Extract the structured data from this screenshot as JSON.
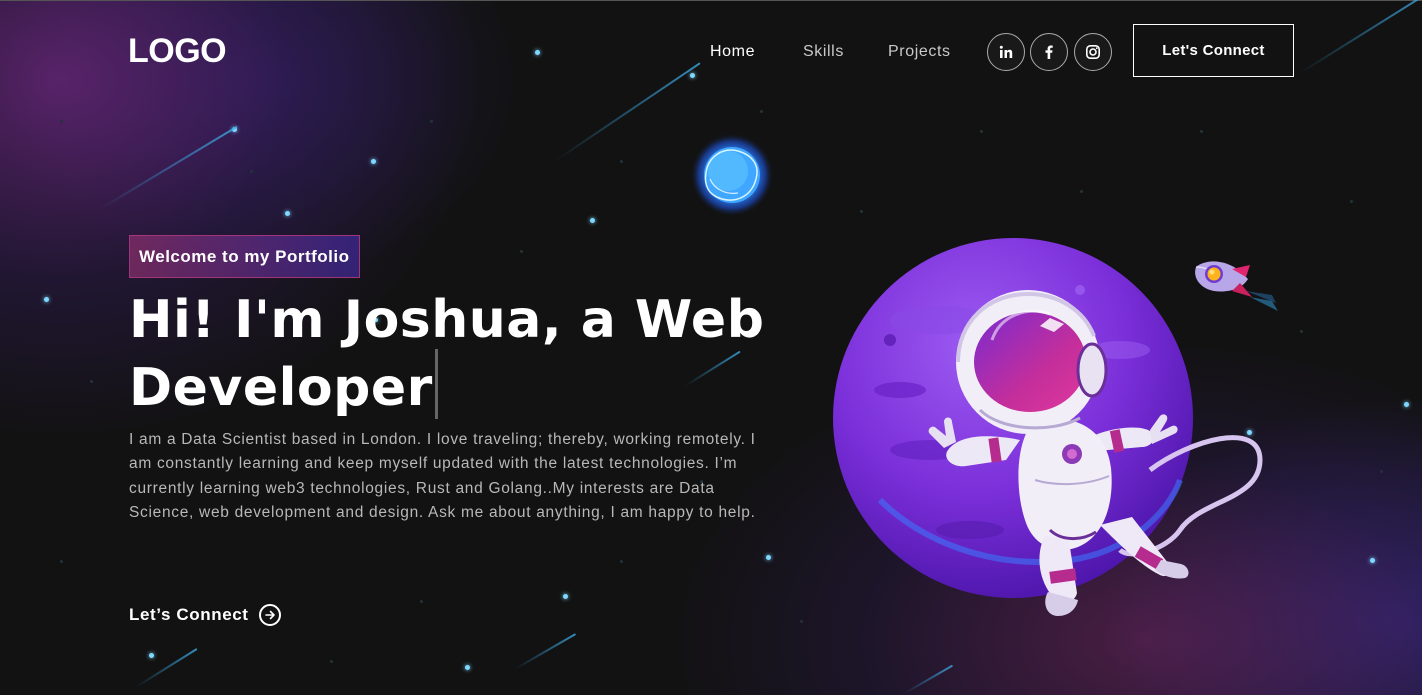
{
  "navbar": {
    "logo": "LOGO",
    "links": [
      {
        "label": "Home",
        "active": true
      },
      {
        "label": "Skills",
        "active": false
      },
      {
        "label": "Projects",
        "active": false
      }
    ],
    "social_icons": [
      "linkedin-icon",
      "facebook-icon",
      "instagram-icon"
    ],
    "connect_label": "Let's Connect"
  },
  "hero": {
    "tagline": "Welcome to my Portfolio",
    "headline": "Hi! I'm Joshua, a Web Developer",
    "bio": "I am a Data Scientist based in London. I love traveling; thereby, working remotely. I am constantly learning and keep myself updated with the latest technologies. I’m currently learning web3 technologies, Rust and Golang..My interests are Data Science, web development and design. Ask me about anything, I am happy to help.",
    "cta_label": "Let’s Connect",
    "cta_icon": "arrow-right-circle-icon"
  },
  "illustration": {
    "name": "astronaut-on-planet",
    "accent_colors": {
      "planet": "#7b2fd9",
      "suit": "#f2eef8",
      "visor": "#c42e9b",
      "moon": "#3fb6ff"
    }
  },
  "theme": {
    "background": "#121212",
    "gradient_pink": "#aa367c",
    "gradient_purple": "#4a2fbd"
  }
}
